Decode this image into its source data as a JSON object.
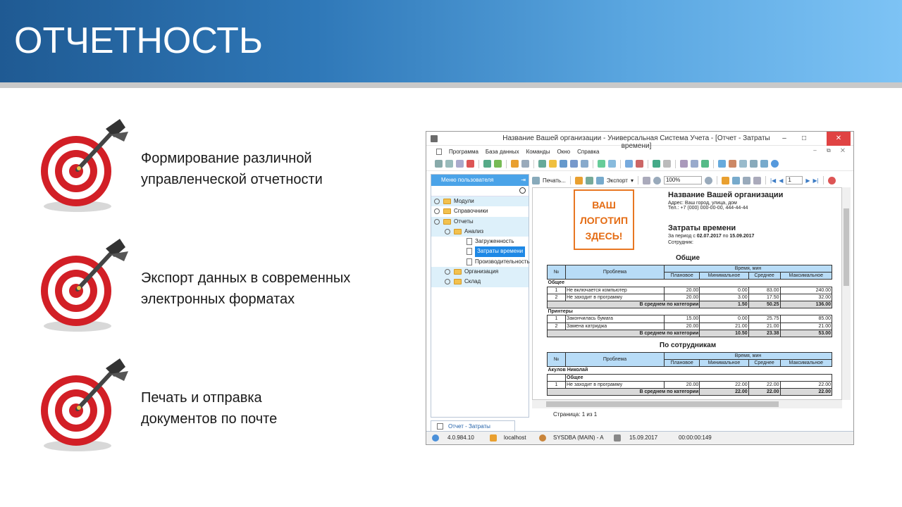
{
  "slide": {
    "title": "ОТЧЕТНОСТЬ",
    "bullets": [
      {
        "line1": "Формирование различной",
        "line2": "управленческой отчетности"
      },
      {
        "line1": "Экспорт данных в современных",
        "line2": "электронных форматах"
      },
      {
        "line1": "Печать и отправка",
        "line2": "документов по почте"
      }
    ]
  },
  "window": {
    "title": "Название Вашей организации - Универсальная Система Учета - [Отчет - Затраты времени]",
    "controls": {
      "minimize": "–",
      "maximize": "□",
      "close": "✕"
    },
    "menu": [
      "Программа",
      "База данных",
      "Команды",
      "Окно",
      "Справка"
    ],
    "mdi_controls": "– ⧉ ✕"
  },
  "sidebar": {
    "title": "Меню пользователя",
    "pin": "⇥",
    "tree": [
      {
        "label": "Модули",
        "level": 0,
        "kind": "folder",
        "expand": "+"
      },
      {
        "label": "Справочники",
        "level": 0,
        "kind": "folder",
        "expand": "+"
      },
      {
        "label": "Отчеты",
        "level": 0,
        "kind": "folder",
        "expand": "−"
      },
      {
        "label": "Анализ",
        "level": 1,
        "kind": "folder",
        "expand": "−"
      },
      {
        "label": "Загруженность",
        "level": 2,
        "kind": "doc"
      },
      {
        "label": "Затраты времени",
        "level": 2,
        "kind": "doc",
        "selected": true
      },
      {
        "label": "Производительность",
        "level": 2,
        "kind": "doc"
      },
      {
        "label": "Организация",
        "level": 1,
        "kind": "folder",
        "expand": "+"
      },
      {
        "label": "Склад",
        "level": 1,
        "kind": "folder",
        "expand": "+"
      }
    ]
  },
  "report_toolbar": {
    "print_label": "Печать...",
    "export_label": "Экспорт",
    "zoom": "100%",
    "page": "1"
  },
  "report": {
    "logo_lines": [
      "ВАШ",
      "ЛОГОТИП",
      "ЗДЕСЬ!"
    ],
    "org_name": "Название Вашей организации",
    "address": "Адрес: Ваш город, улица, дом",
    "phone": "Тел.: +7 (000) 000-00-00, 444-44-44",
    "title": "Затраты времени",
    "period_prefix": "За период с ",
    "period_from": "02.07.2017",
    "period_mid": " по ",
    "period_to": "15.09.2017",
    "employee": "Сотрудник:",
    "section1": "Общие",
    "section2": "По сотрудникам",
    "headers": {
      "num": "№",
      "problem": "Проблема",
      "time": "Время, мин",
      "plan": "Плановое",
      "min": "Минимальное",
      "avg": "Среднее",
      "max": "Максимальное"
    },
    "avg_label": "В среднем по категории",
    "table1": {
      "groups": [
        {
          "name": "Общее",
          "rows": [
            {
              "n": "1",
              "problem": "Не включается компьютер",
              "plan": "20.00",
              "min": "0.00",
              "avg": "83.00",
              "max": "240.00"
            },
            {
              "n": "2",
              "problem": "Не заходит в программу",
              "plan": "20.00",
              "min": "3.00",
              "avg": "17.50",
              "max": "32.00"
            }
          ],
          "summary": {
            "min": "1.50",
            "avg": "50.25",
            "max": "136.00"
          }
        },
        {
          "name": "Принтеры",
          "rows": [
            {
              "n": "1",
              "problem": "Закончилась бумага",
              "plan": "15.00",
              "min": "0.00",
              "avg": "25.75",
              "max": "85.00"
            },
            {
              "n": "2",
              "problem": "Замена катриджа",
              "plan": "20.00",
              "min": "21.00",
              "avg": "21.00",
              "max": "21.00"
            }
          ],
          "summary": {
            "min": "10.50",
            "avg": "23.38",
            "max": "53.00"
          }
        }
      ]
    },
    "table2": {
      "employee": "Акулов Николай",
      "group": "Общее",
      "rows": [
        {
          "n": "1",
          "problem": "Не заходит в программу",
          "plan": "20.00",
          "min": "22.00",
          "avg": "22.00",
          "max": "22.00"
        }
      ],
      "summary": {
        "min": "22.00",
        "avg": "22.00",
        "max": "22.00"
      }
    }
  },
  "page_info": "Страница: 1 из 1",
  "doc_tab": "Отчет - Затраты времени",
  "status": {
    "version": "4.0.984.10",
    "server": "localhost",
    "user": "SYSDBA (MAIN) - A",
    "date": "15.09.2017",
    "timer": "00:00:00:149"
  }
}
